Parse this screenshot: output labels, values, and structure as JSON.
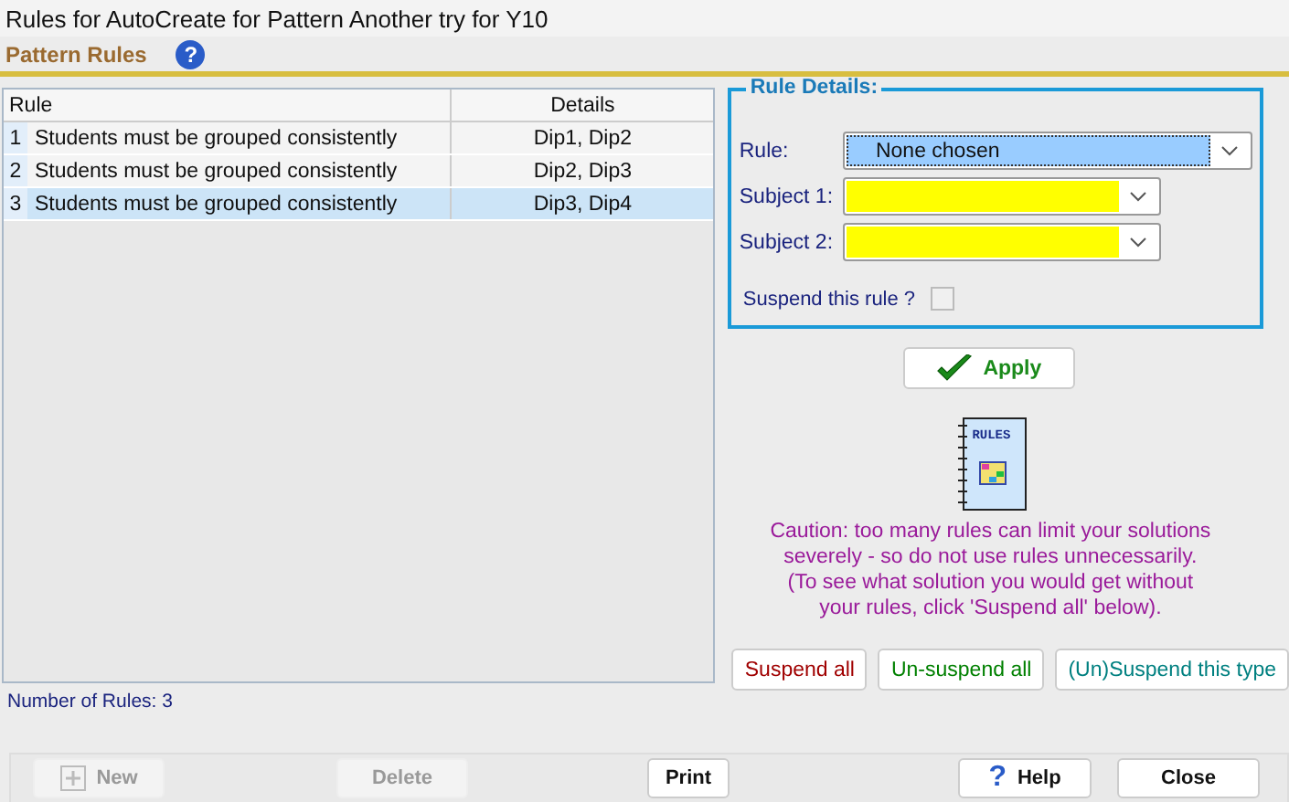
{
  "window": {
    "title": "Rules for AutoCreate for Pattern Another try for Y10"
  },
  "header": {
    "title": "Pattern Rules",
    "help_glyph": "?"
  },
  "table": {
    "columns": [
      "Rule",
      "Details"
    ],
    "rows": [
      {
        "number": "1",
        "rule": "Students must be grouped consistently",
        "details": "Dip1, Dip2",
        "selected": false
      },
      {
        "number": "2",
        "rule": "Students must be grouped consistently",
        "details": "Dip2, Dip3",
        "selected": false
      },
      {
        "number": "3",
        "rule": "Students must be grouped consistently",
        "details": "Dip3, Dip4",
        "selected": true
      }
    ]
  },
  "rule_details": {
    "title": "Rule Details:",
    "fields": [
      {
        "label": "Rule:",
        "value": "None chosen",
        "highlighted": true,
        "wide": true
      },
      {
        "label": "Subject 1:",
        "highlighted": false,
        "wide": false
      },
      {
        "label": "Subject 2:",
        "highlighted": false,
        "wide": false
      }
    ],
    "suspend": {
      "label": "Suspend this rule ?",
      "checked": false
    }
  },
  "apply_button": "Apply",
  "rules_icon_text": "RULES",
  "caution": [
    "Caution: too many rules can limit your solutions",
    "severely - so do not use rules unnecessarily.",
    "(To see what solution you would get without",
    "your rules, click 'Suspend all' below)."
  ],
  "suspend_buttons": [
    {
      "label": "Suspend all",
      "color": "#a00000"
    },
    {
      "label": "Un-suspend all",
      "color": "#008000"
    },
    {
      "label": "(Un)Suspend this type",
      "color": "#008080"
    }
  ],
  "rule_count": "Number of Rules: 3",
  "footer_buttons": [
    {
      "label": "New",
      "kind": "new",
      "disabled": true
    },
    {
      "label": "Delete",
      "kind": "plain",
      "disabled": true
    },
    {
      "label": "Print",
      "kind": "plain",
      "disabled": false
    },
    {
      "label": "Help",
      "kind": "help",
      "icon": "?",
      "disabled": false
    },
    {
      "label": "Close",
      "kind": "plain",
      "disabled": false
    }
  ]
}
